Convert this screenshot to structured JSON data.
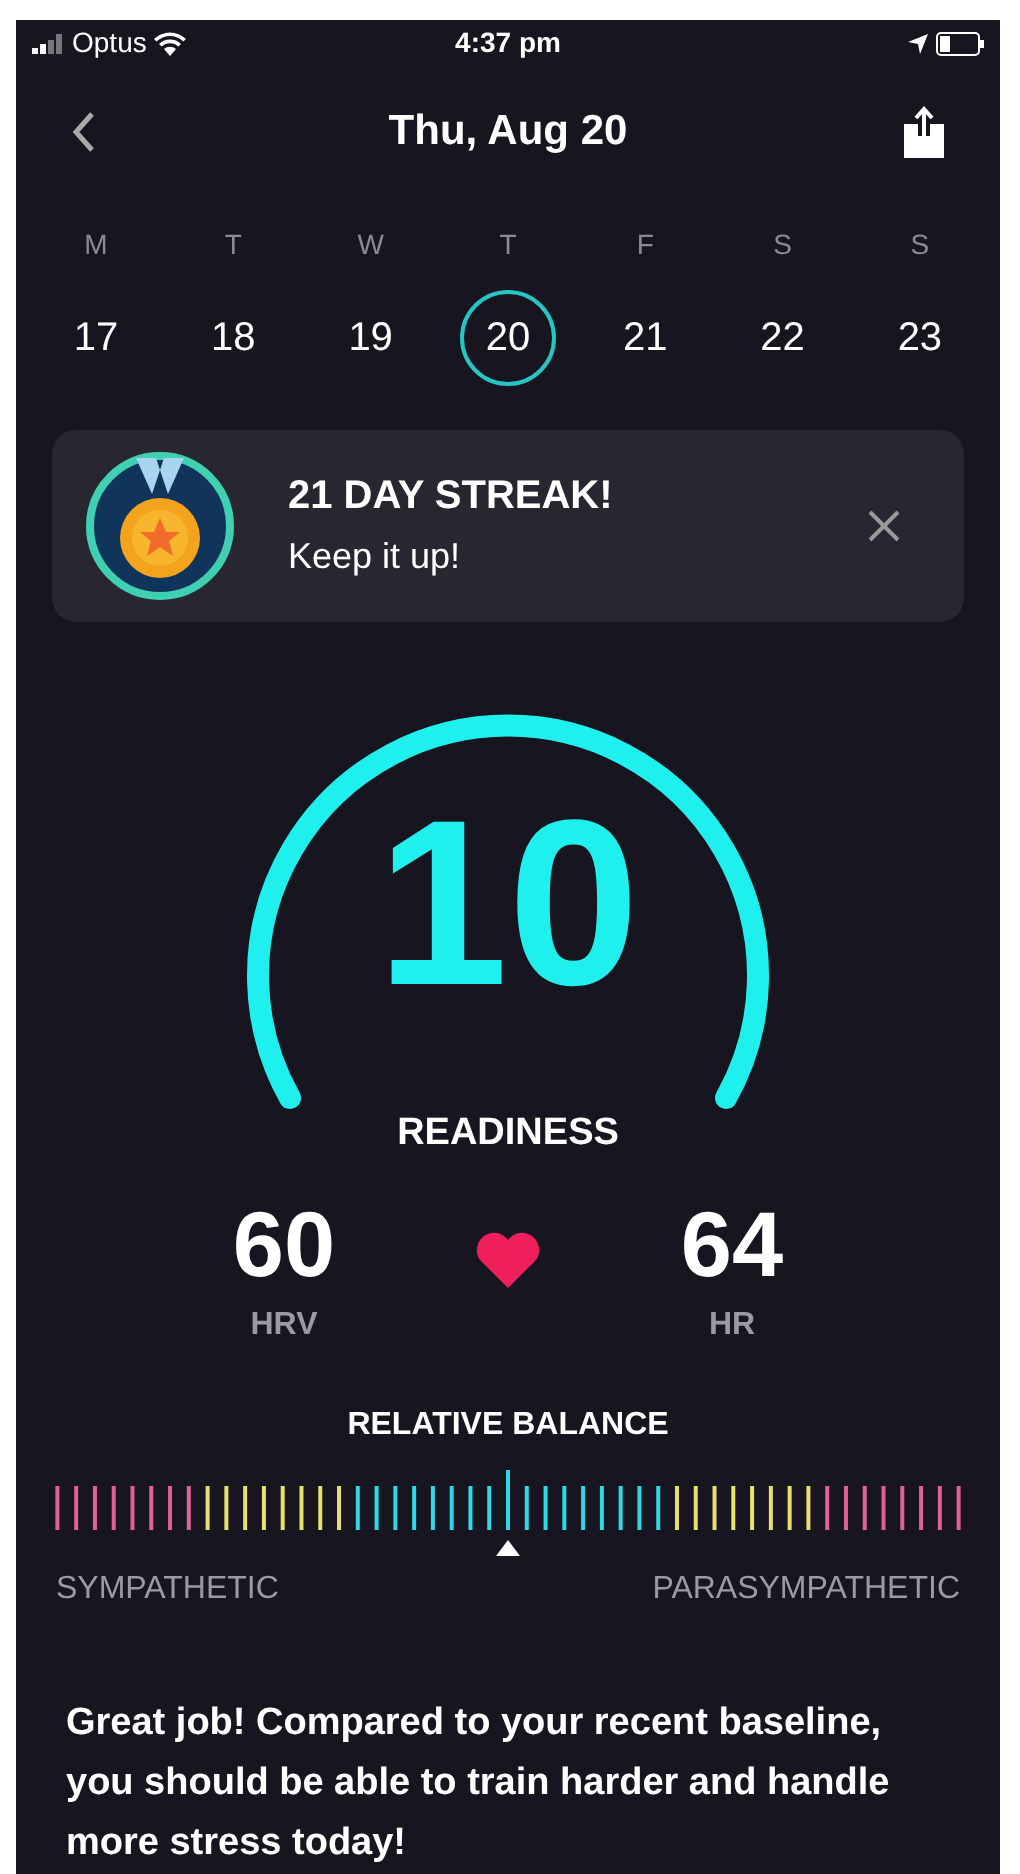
{
  "status_bar": {
    "carrier": "Optus",
    "time": "4:37 pm"
  },
  "header": {
    "title": "Thu, Aug 20"
  },
  "week": [
    {
      "weekday": "M",
      "day": "17",
      "selected": false
    },
    {
      "weekday": "T",
      "day": "18",
      "selected": false
    },
    {
      "weekday": "W",
      "day": "19",
      "selected": false
    },
    {
      "weekday": "T",
      "day": "20",
      "selected": true
    },
    {
      "weekday": "F",
      "day": "21",
      "selected": false
    },
    {
      "weekday": "S",
      "day": "22",
      "selected": false
    },
    {
      "weekday": "S",
      "day": "23",
      "selected": false
    }
  ],
  "streak_card": {
    "title": "21 DAY STREAK!",
    "subtitle": "Keep it up!"
  },
  "readiness": {
    "score": "10",
    "label": "READINESS"
  },
  "metrics": [
    {
      "value": "60",
      "label": "HRV"
    },
    {
      "value": "64",
      "label": "HR"
    }
  ],
  "balance": {
    "title": "RELATIVE BALANCE",
    "left_label": "SYMPATHETIC",
    "right_label": "PARASYMPATHETIC"
  },
  "message": "Great job! Compared to your recent baseline, you should be able to train harder and handle more stress today!"
}
